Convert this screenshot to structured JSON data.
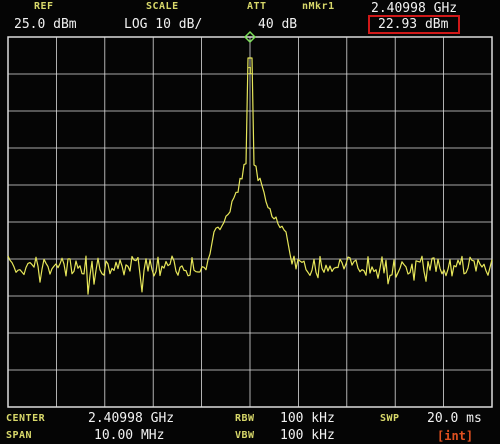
{
  "header": {
    "ref_label": "REF",
    "ref_value": "25.0 dBm",
    "scale_label": "SCALE",
    "scale_value": "LOG 10 dB/",
    "att_label": "ATT",
    "att_value": "40 dB",
    "marker_label": "nMkr1",
    "marker_freq": "2.40998 GHz",
    "marker_level": "22.93 dBm"
  },
  "marker": {
    "number": "1"
  },
  "footer": {
    "center_label": "CENTER",
    "center_value": "2.40998 GHz",
    "span_label": "SPAN",
    "span_value": "10.00 MHz",
    "rbw_label": "RBW",
    "rbw_value": "100 kHz",
    "vbw_label": "VBW",
    "vbw_value": "100 kHz",
    "swp_label": "SWP",
    "swp_value": "20.0 ms",
    "int_flag": "[int]"
  },
  "colors": {
    "trace": "#e6e65a",
    "grid": "#dcdcdc",
    "marker": "#7ee05a",
    "highlight": "#d01818"
  }
}
